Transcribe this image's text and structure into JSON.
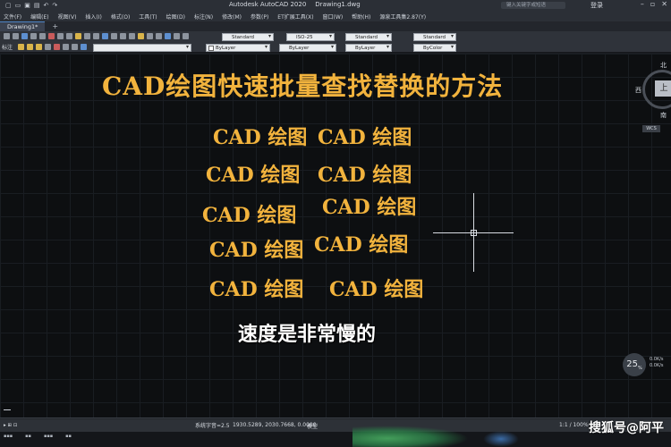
{
  "titlebar": {
    "app": "Autodesk AutoCAD 2020",
    "file": "Drawing1.dwg",
    "search_placeholder": "键入关键字或短语",
    "login": "登录"
  },
  "menu": [
    "文件(F)",
    "编辑(E)",
    "视图(V)",
    "插入(I)",
    "格式(O)",
    "工具(T)",
    "绘图(D)",
    "标注(N)",
    "修改(M)",
    "参数(P)",
    "ET扩展工具(X)",
    "窗口(W)",
    "帮助(H)",
    "源泉工具集2.87(Y)"
  ],
  "tabs": {
    "active": "Drawing1*",
    "add": "+"
  },
  "toolbar": {
    "left_label": "标注",
    "style_dd1": "Standard",
    "dimstyle": "ISO-25",
    "style_dd3": "Standard",
    "style_dd4": "Standard",
    "layer1": "ByLayer",
    "layer2": "ByLayer",
    "layer3": "ByLayer",
    "color": "ByColor"
  },
  "canvas": {
    "heading": "CAD绘图快速批量查找替换的方法",
    "labels": [
      "CAD 绘图",
      "CAD 绘图",
      "CAD 绘图",
      "CAD 绘图",
      "CAD 绘图",
      "CAD 绘图",
      "CAD 绘图",
      "CAD 绘图",
      "CAD 绘图",
      "CAD 绘图"
    ],
    "subtitle": "速度是非常慢的"
  },
  "viewcube": {
    "north": "北",
    "west": "西",
    "south": "南",
    "top": "上",
    "wcs": "WCS"
  },
  "navbar": {
    "badge": "25",
    "badge_unit": "%",
    "stat1": "0.0K/s",
    "stat2": "0.0K/s"
  },
  "status": {
    "ratio": "系统字音=2.5",
    "coords": "1930.5289, 2030.7668, 0.0000",
    "model": "模型",
    "scale": "1:1 / 100%"
  },
  "watermark": "搜狐号@阿平"
}
